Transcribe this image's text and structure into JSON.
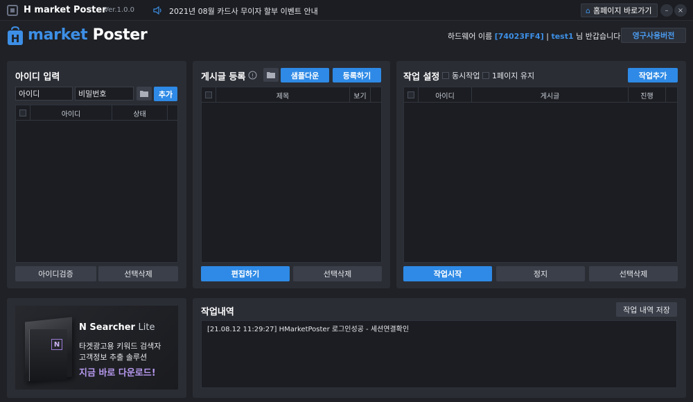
{
  "titlebar": {
    "app_name": "H market Poster",
    "version": "Ver.1.0.0",
    "notice": "2021년 08월 카드사 무이자 할부 이벤트 안내",
    "home_link": "홈페이지 바로가기",
    "minimize": "–",
    "close": "×"
  },
  "header": {
    "brand_m": "market",
    "brand_p": "Poster",
    "hw_prefix": "하드웨어 이름",
    "hw_id": "[74023FF4]",
    "sep": "|",
    "user": "test1",
    "greeting": "님 반갑습니다!",
    "perm_button": "영구사용버전"
  },
  "id_panel": {
    "title": "아이디 입력",
    "id_placeholder": "아이디",
    "pw_placeholder": "비밀번호",
    "add_button": "추가",
    "col_id": "아이디",
    "col_status": "상태",
    "verify_button": "아이디검증",
    "delete_button": "선택삭제"
  },
  "post_panel": {
    "title": "게시글 등록",
    "sample_button": "샘플다운",
    "register_button": "등록하기",
    "col_title": "제목",
    "col_view": "보기",
    "edit_button": "편집하기",
    "delete_button": "선택삭제"
  },
  "task_panel": {
    "title": "작업 설정",
    "concurrent_label": "동시작업",
    "keep_page_label": "1페이지 유지",
    "add_button": "작업추가",
    "col_id": "아이디",
    "col_post": "게시글",
    "col_progress": "진행",
    "start_button": "작업시작",
    "stop_button": "정지",
    "delete_button": "선택삭제"
  },
  "ad": {
    "product": "N Searcher",
    "edition": "Lite",
    "line1": "타겟광고용 키워드 검색자",
    "line2": "고객정보 추출 솔루션",
    "cta": "지금 바로 다운로드!",
    "box_letter": "N"
  },
  "log_panel": {
    "title": "작업내역",
    "save_button": "작업 내역 저장",
    "entries": [
      "[21.08.12 11:29:27]   HMarketPoster 로그인성공 - 세션연결확인"
    ]
  },
  "colors": {
    "accent": "#2e8ae6",
    "background": "#1f2126",
    "panel": "#2a2d34",
    "ad_highlight": "#b99bf2"
  }
}
